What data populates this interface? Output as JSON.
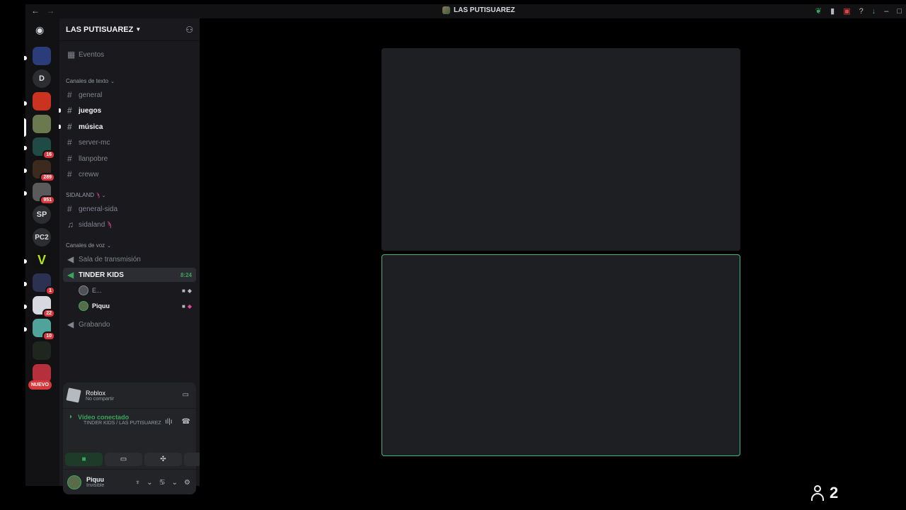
{
  "window": {
    "title": "LAS PUTISUAREZ",
    "back_icon": "←",
    "forward_icon": "→"
  },
  "rail": {
    "letters": [
      "D",
      "SP",
      "PC2"
    ],
    "badges": [
      "16",
      "289",
      "951",
      "1",
      "22",
      "10"
    ],
    "new_label": "NUEVO"
  },
  "server": {
    "name": "LAS PUTISUAREZ",
    "events_label": "Eventos",
    "text_category": "Canales de texto",
    "text_channels": [
      "general",
      "juegos",
      "música",
      "server-mc",
      "llanpobre",
      "creww"
    ],
    "sida_category": "SIDALAND",
    "sida_channels": [
      "general-sida",
      "sidaland"
    ],
    "voice_category": "Canales de voz",
    "voice_channels": [
      "Sala de transmisión",
      "TINDER KIDS",
      "Grabando"
    ],
    "active_timer": "8:24",
    "voice_users": [
      "E...",
      "Piquu"
    ]
  },
  "activity": {
    "title": "Roblox",
    "subtitle": "No compartir"
  },
  "rtc": {
    "state": "Vídeo conectado",
    "location": "TINDER KIDS / LAS PUTISUAREZ"
  },
  "user": {
    "name": "Piquu",
    "status": "Invisible"
  },
  "participants": {
    "count": "2"
  },
  "colors": {
    "accent_green": "#3ba55d",
    "badge_red": "#da373c",
    "speaking_border": "#43b581"
  }
}
